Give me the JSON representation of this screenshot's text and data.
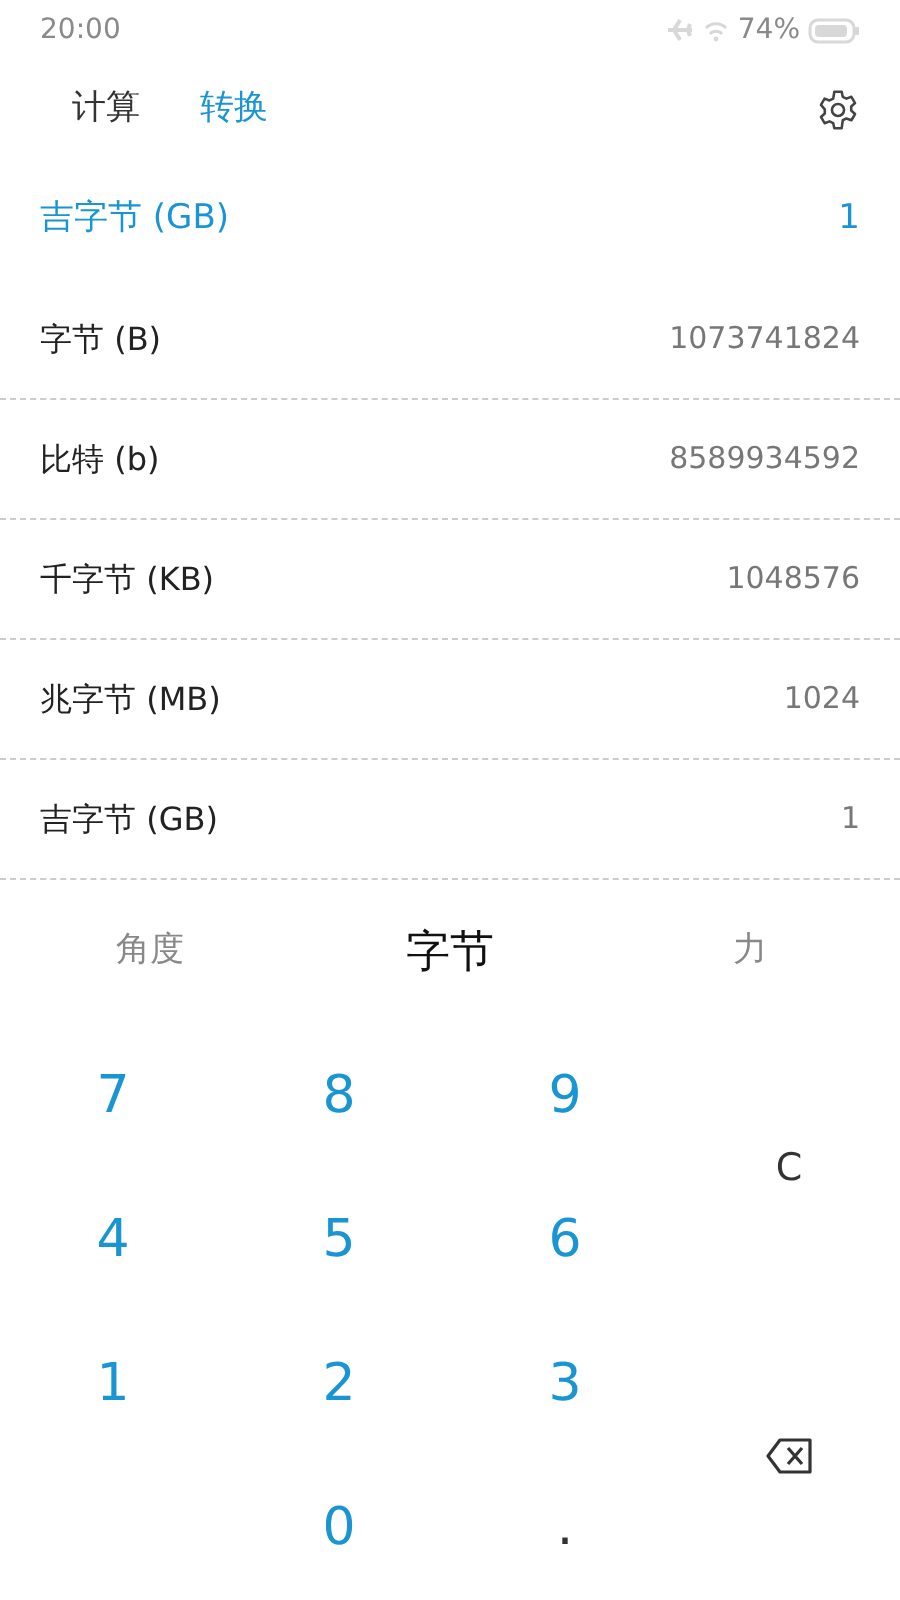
{
  "status_bar": {
    "time": "20:00",
    "battery": "74%"
  },
  "tabs": [
    {
      "label": "计算",
      "selected": false
    },
    {
      "label": "转换",
      "selected": true
    }
  ],
  "current": {
    "unit": "吉字节 (GB)",
    "value": "1"
  },
  "units": [
    {
      "name": "字节 (B)",
      "value": "1073741824"
    },
    {
      "name": "比特 (b)",
      "value": "8589934592"
    },
    {
      "name": "千字节 (KB)",
      "value": "1048576"
    },
    {
      "name": "兆字节 (MB)",
      "value": "1024"
    },
    {
      "name": "吉字节 (GB)",
      "value": "1"
    }
  ],
  "categories": [
    {
      "label": "角度",
      "selected": false
    },
    {
      "label": "字节",
      "selected": true
    },
    {
      "label": "力",
      "selected": false
    }
  ],
  "keypad": {
    "rows": [
      [
        "7",
        "8",
        "9"
      ],
      [
        "4",
        "5",
        "6"
      ],
      [
        "1",
        "2",
        "3"
      ]
    ],
    "zero": "0",
    "point": ".",
    "clear": "C"
  }
}
